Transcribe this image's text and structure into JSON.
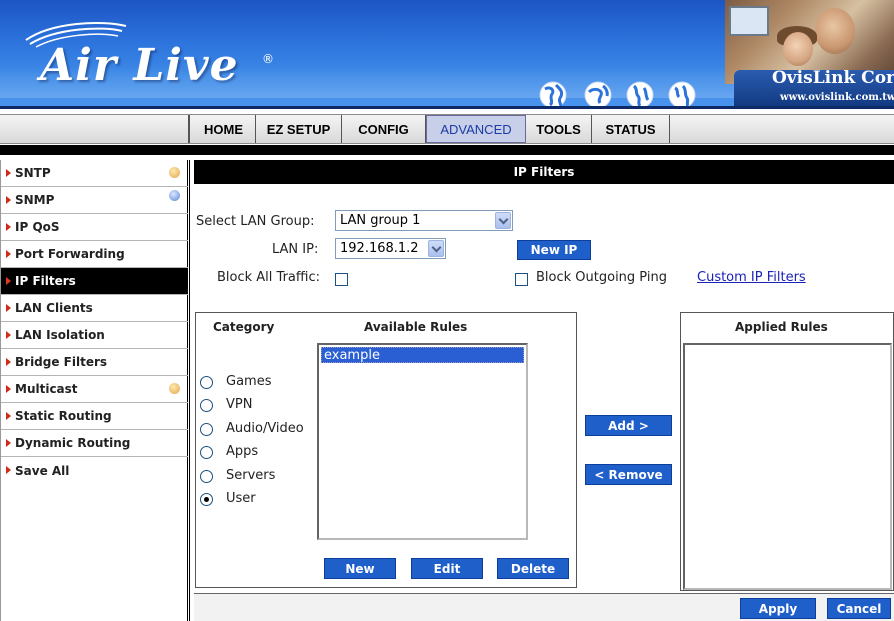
{
  "banner": {
    "logo_text": "Air Live",
    "logo_reg": "®",
    "company": "OvisLink Corp.",
    "company_url": "www.ovislink.com.tw"
  },
  "nav": {
    "tabs": [
      {
        "label": "HOME",
        "active": false
      },
      {
        "label": "EZ SETUP",
        "active": false
      },
      {
        "label": "CONFIG",
        "active": false
      },
      {
        "label": "ADVANCED",
        "active": true
      },
      {
        "label": "TOOLS",
        "active": false
      },
      {
        "label": "STATUS",
        "active": false
      }
    ]
  },
  "sidebar": {
    "items": [
      {
        "label": "SNTP",
        "dot": "orange"
      },
      {
        "label": "SNMP",
        "dot": "blue"
      },
      {
        "label": "IP QoS"
      },
      {
        "label": "Port Forwarding"
      },
      {
        "label": "IP Filters",
        "active": true
      },
      {
        "label": "LAN Clients"
      },
      {
        "label": "LAN Isolation"
      },
      {
        "label": "Bridge Filters"
      },
      {
        "label": "Multicast",
        "dot": "orange"
      },
      {
        "label": "Static Routing"
      },
      {
        "label": "Dynamic Routing"
      },
      {
        "label": "Save All"
      }
    ]
  },
  "main": {
    "title": "IP Filters",
    "lan_group_label": "Select LAN Group:",
    "lan_group_value": "LAN group 1",
    "lan_ip_label": "LAN IP:",
    "lan_ip_value": "192.168.1.2",
    "new_ip_button": "New IP",
    "block_all_label": "Block All Traffic:",
    "block_all_checked": false,
    "block_ping_label": "Block Outgoing Ping",
    "block_ping_checked": false,
    "custom_link": "Custom IP Filters"
  },
  "rules": {
    "category_header": "Category",
    "available_header": "Available Rules",
    "applied_header": "Applied Rules",
    "categories": [
      {
        "label": "Games",
        "selected": false
      },
      {
        "label": "VPN",
        "selected": false
      },
      {
        "label": "Audio/Video",
        "selected": false
      },
      {
        "label": "Apps",
        "selected": false
      },
      {
        "label": "Servers",
        "selected": false
      },
      {
        "label": "User",
        "selected": true
      }
    ],
    "available_items": [
      "example"
    ],
    "applied_items": [],
    "add_button": "Add >",
    "remove_button": "< Remove",
    "new_button": "New",
    "edit_button": "Edit",
    "delete_button": "Delete"
  },
  "footer": {
    "apply_button": "Apply",
    "cancel_button": "Cancel"
  },
  "colors": {
    "button_blue": "#1f5fc9",
    "active_tab_bg": "#c8cfe8",
    "sidebar_arrow": "#d02a1a",
    "banner_blue": "#2c73dc"
  }
}
